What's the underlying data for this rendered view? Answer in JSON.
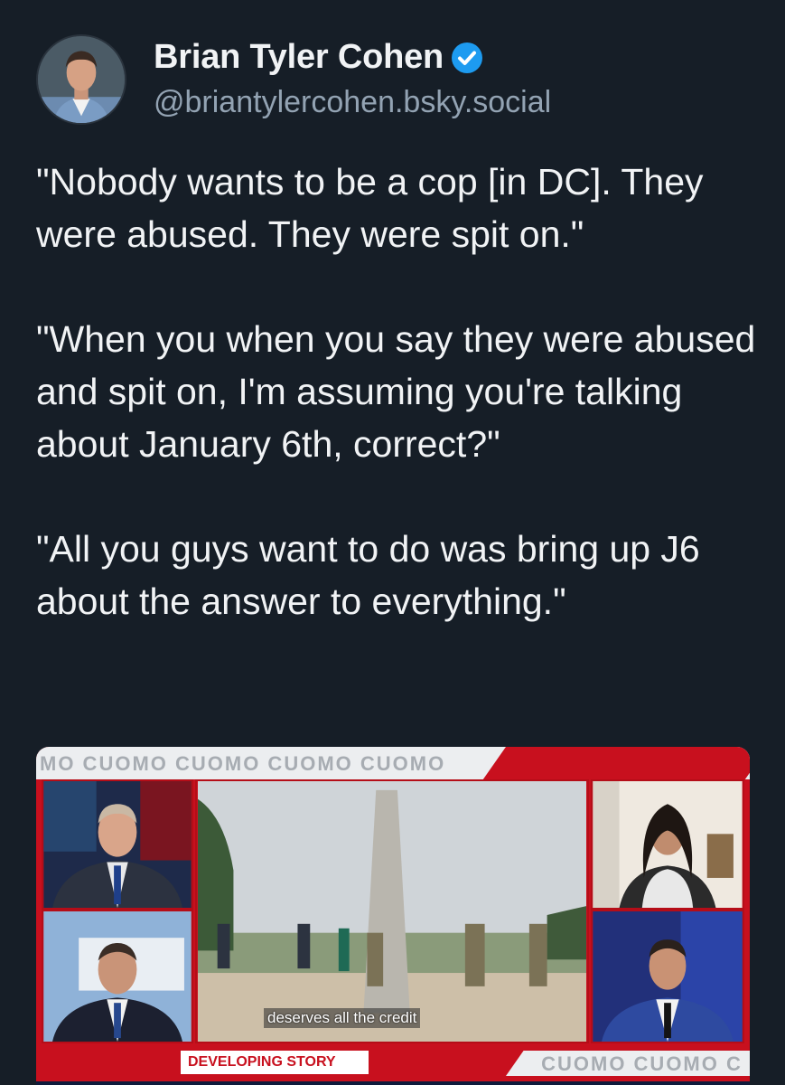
{
  "author": {
    "display_name": "Brian Tyler Cohen",
    "handle": "@briantylercohen.bsky.social",
    "verified_icon": "verified-check-icon",
    "verified_color": "#1d9bf0"
  },
  "post": {
    "paragraphs": [
      "\"Nobody wants to be a cop [in DC]. They were abused. They were spit on.\"",
      "\"When you when you say they were abused and spit on, I'm assuming you're talking about January 6th, correct?\"",
      "\"All you guys want to do was bring up J6 about the answer to everything.\""
    ]
  },
  "media": {
    "banner_text": "MO CUOMO CUOMO CUOMO CUOMO",
    "caption": "deserves all the credit",
    "lower_third_label": "DEVELOPING STORY",
    "ticker_text": "CUOMO CUOMO C",
    "accent_color": "#c8101e"
  }
}
